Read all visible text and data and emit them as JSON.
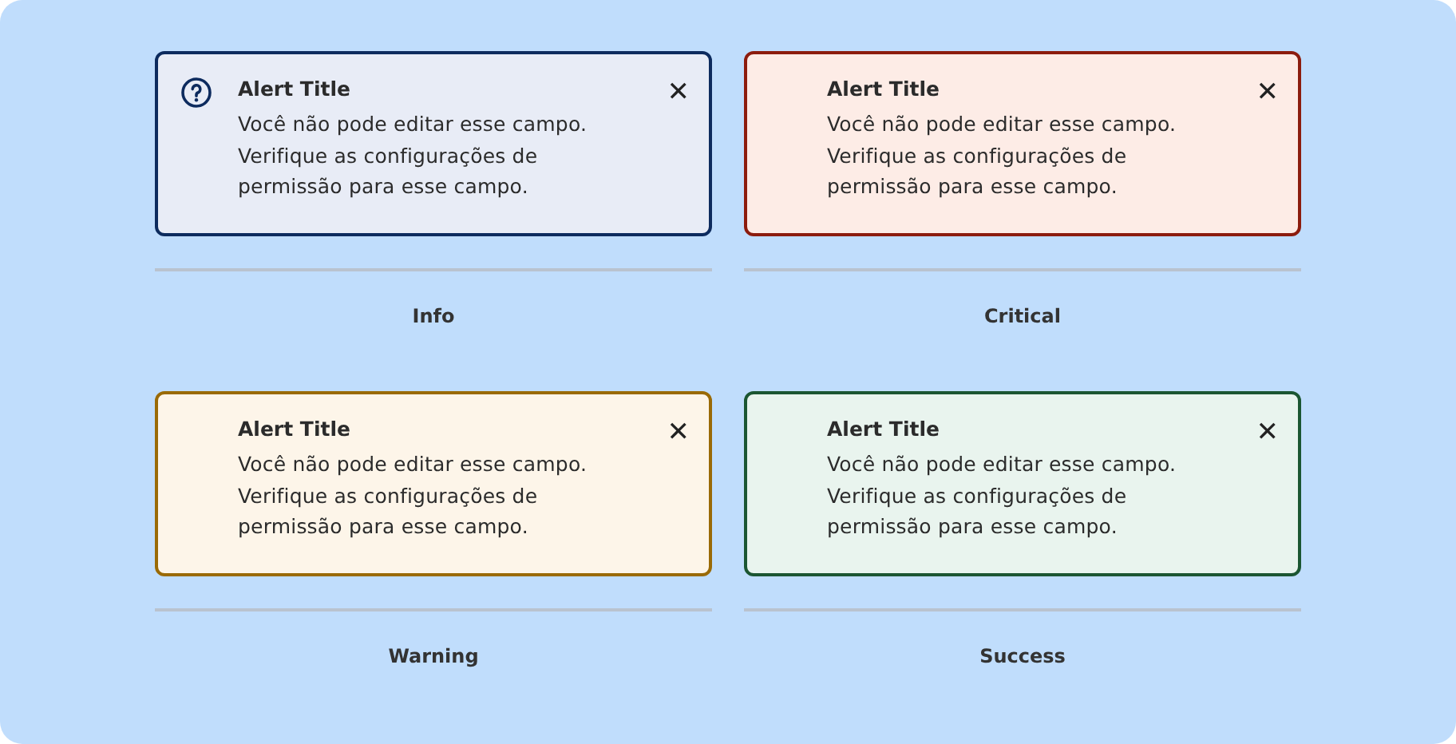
{
  "alerts": [
    {
      "kind": "info",
      "has_icon": true,
      "title": "Alert Title",
      "message": "Você não pode editar esse campo. Verifique as configurações de permissão para esse campo.",
      "close": "✕",
      "caption": "Info"
    },
    {
      "kind": "critical",
      "has_icon": false,
      "title": "Alert Title",
      "message": "Você não pode editar esse campo. Verifique as configurações de permissão para esse campo.",
      "close": "✕",
      "caption": "Critical"
    },
    {
      "kind": "warning",
      "has_icon": false,
      "title": "Alert Title",
      "message": "Você não pode editar esse campo. Verifique as configurações de permissão para esse campo.",
      "close": "✕",
      "caption": "Warning"
    },
    {
      "kind": "success",
      "has_icon": false,
      "title": "Alert Title",
      "message": "Você não pode editar esse campo. Verifique as configurações de permissão para esse campo.",
      "close": "✕",
      "caption": "Success"
    }
  ]
}
